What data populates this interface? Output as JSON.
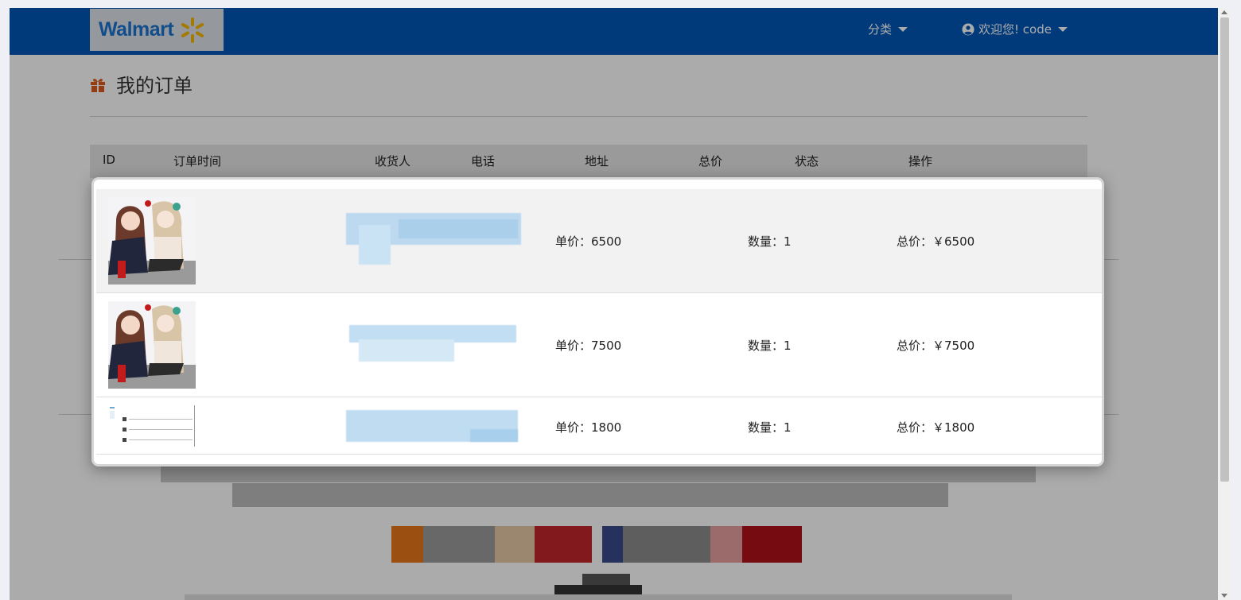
{
  "navbar": {
    "logo_text": "Walmart",
    "category_label": "分类",
    "user_label": "欢迎您! code",
    "bg_color": "#0157b8"
  },
  "page": {
    "title": "我的订单",
    "icon": "gift-icon",
    "accent_color": "#e05a1c"
  },
  "table": {
    "headers": [
      "ID",
      "订单时间",
      "收货人",
      "电话",
      "地址",
      "总价",
      "状态",
      "操作"
    ]
  },
  "modal": {
    "items": [
      {
        "price_label": "单价：6500",
        "qty_label": "数量：1",
        "total_label": "总价：￥6500"
      },
      {
        "price_label": "单价：7500",
        "qty_label": "数量：1",
        "total_label": "总价：￥7500"
      },
      {
        "price_label": "单价：1800",
        "qty_label": "数量：1",
        "total_label": "总价：￥1800"
      }
    ]
  }
}
